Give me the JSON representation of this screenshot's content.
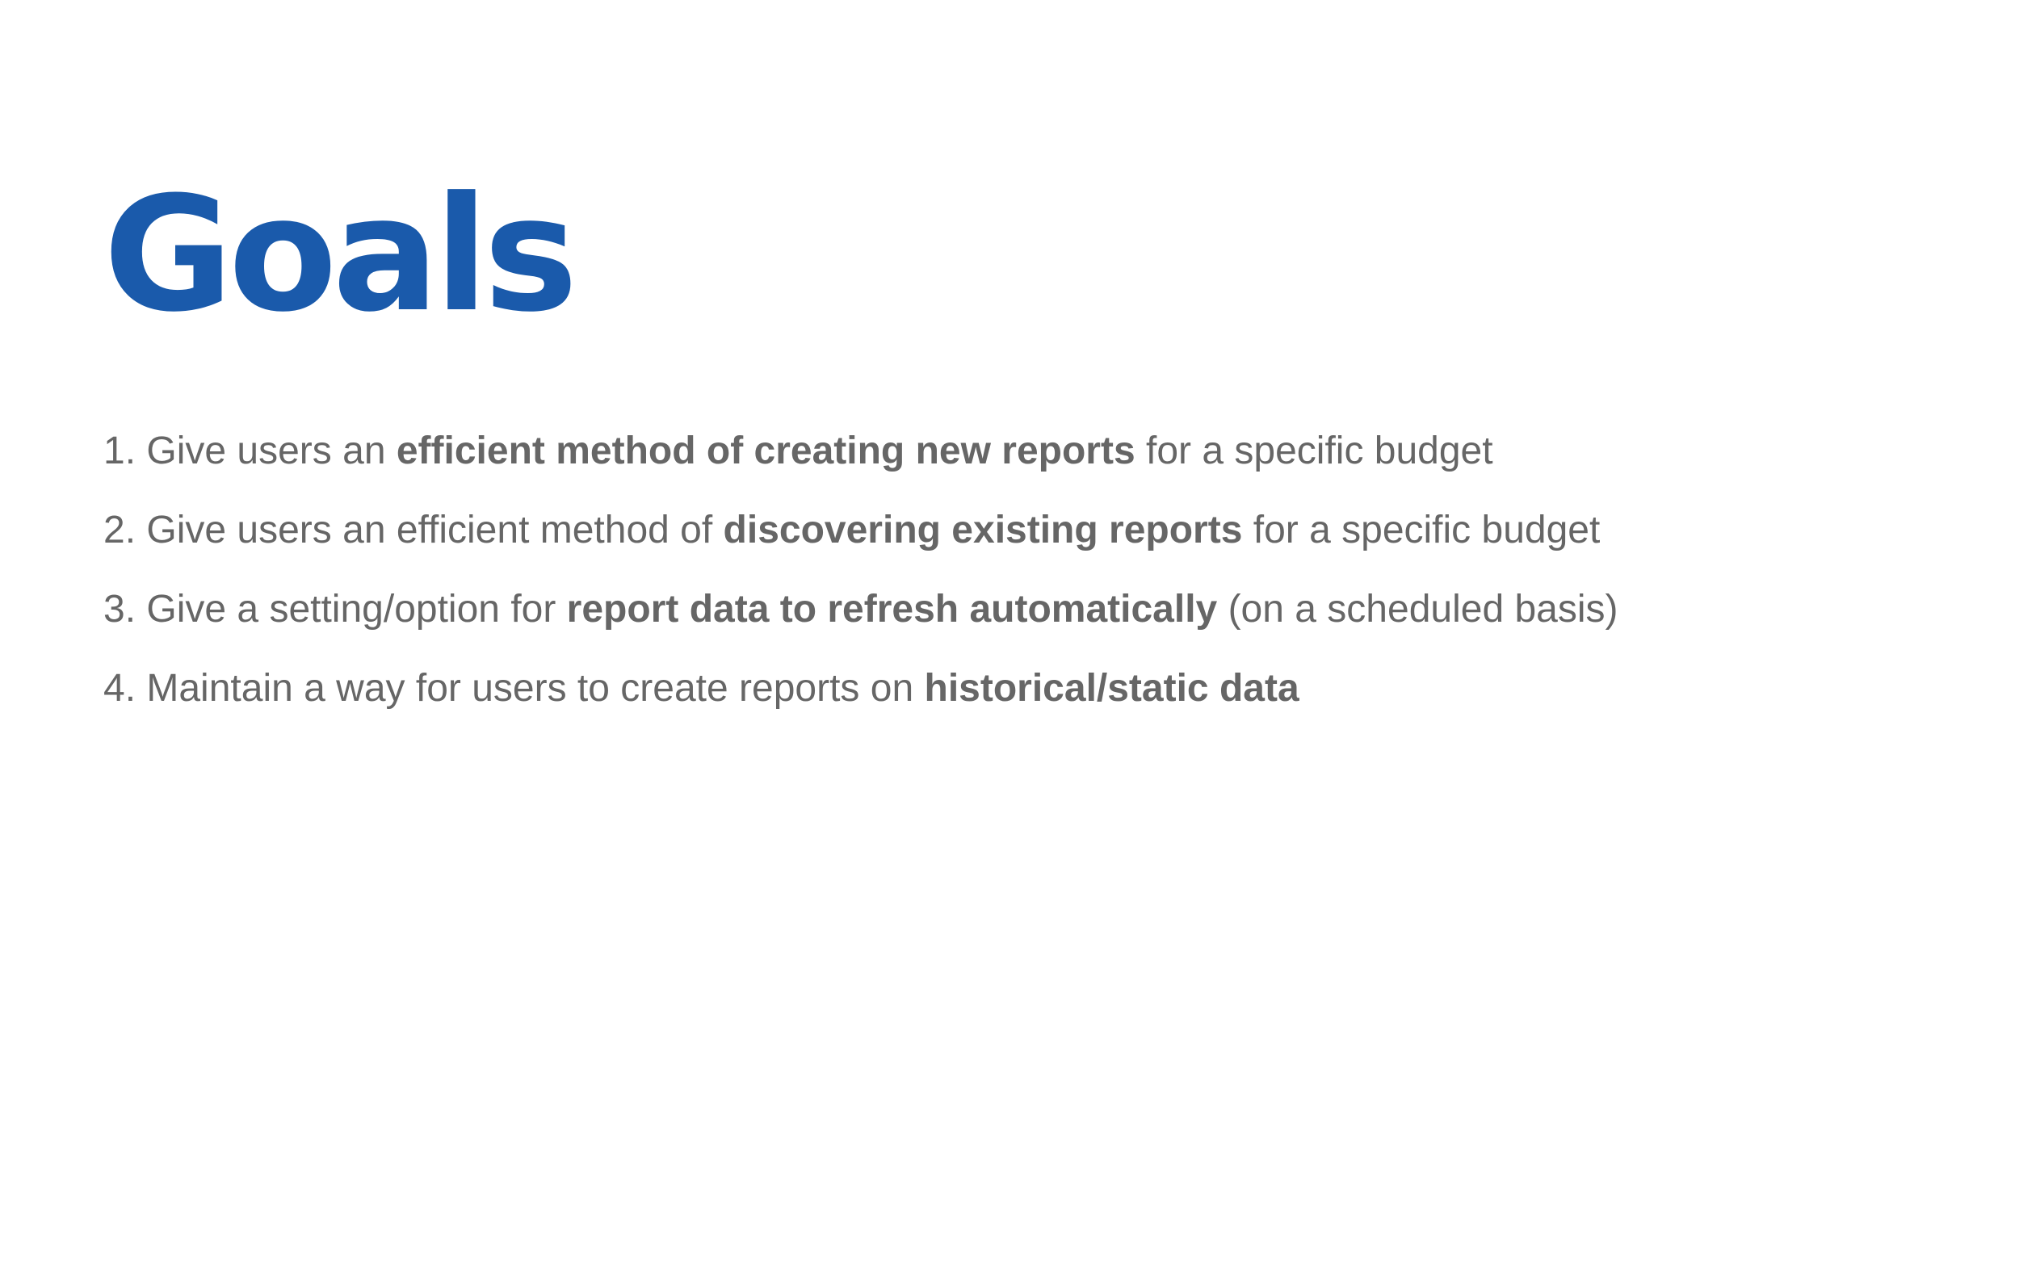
{
  "slide": {
    "title": "Goals",
    "accent_color": "#1a5aab",
    "text_color": "#666666",
    "goals": [
      {
        "number": "1.",
        "before": "Give users an",
        "emphasis": "efficient method of creating new reports",
        "after": "for a specific budget"
      },
      {
        "number": "2.",
        "before": "Give users an efficient method of",
        "emphasis": "discovering existing reports",
        "after": "for a specific budget"
      },
      {
        "number": "3.",
        "before": "Give a setting/option for",
        "emphasis": "report data to refresh automatically",
        "after": "(on a scheduled basis)"
      },
      {
        "number": "4.",
        "before": "Maintain a way for users to create reports on",
        "emphasis": "historical/static data",
        "after": ""
      }
    ]
  }
}
